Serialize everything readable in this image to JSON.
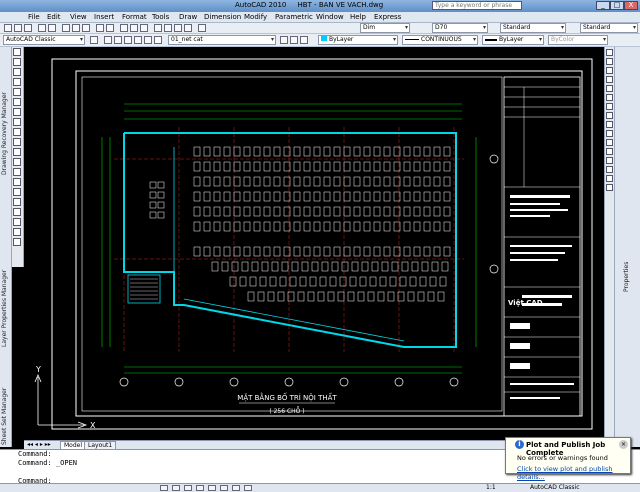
{
  "window": {
    "app_title": "AutoCAD 2010",
    "file_title": "HBT - BAN VE VACH.dwg",
    "search_placeholder": "Type a keyword or phrase",
    "min": "_",
    "max": "□",
    "close": "X"
  },
  "menu": {
    "items": [
      "File",
      "Edit",
      "View",
      "Insert",
      "Format",
      "Tools",
      "Draw",
      "Dimension",
      "Modify",
      "Parametric",
      "Window",
      "Help",
      "Express"
    ]
  },
  "toolbar": {
    "dim_style": "Dim",
    "text_height": "D70",
    "table_style": "Standard",
    "multileader_style": "Standard"
  },
  "properties_bar": {
    "workspace": "AutoCAD Classic",
    "layer": "01_net cat",
    "color": "ByLayer",
    "linetype": "CONTINUOUS",
    "lineweight": "ByLayer",
    "plotstyle": "ByColor"
  },
  "left_palettes": {
    "drawing_recovery": "Drawing Recovery Manager",
    "layer_properties": "Layer Properties Manager",
    "sheet_set": "Sheet Set Manager"
  },
  "right_palette": {
    "properties": "Properties"
  },
  "drawing": {
    "plan_title": "MẶT BẰNG BỐ TRÍ NỘI THẤT",
    "plan_subtitle": "( 256 CHỖ )",
    "title_block_logo": "Việt CAD",
    "ucs_y": "Y",
    "ucs_x": "X"
  },
  "layout_tabs": {
    "model": "Model",
    "layout1": "Layout1"
  },
  "command_line": {
    "lines": [
      "Command:",
      "Command: _OPEN",
      "",
      "Command:"
    ]
  },
  "status": {
    "workspace": "AutoCAD Classic",
    "scale": "1:1"
  },
  "notification": {
    "title": "Plot and Publish Job Complete",
    "message": "No errors or warnings found",
    "link": "Click to view plot and publish details..."
  }
}
